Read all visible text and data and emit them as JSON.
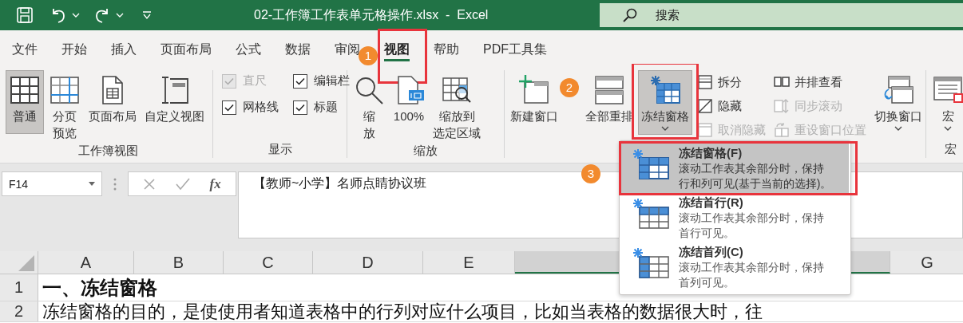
{
  "title_bar": {
    "title": "02-工作簿工作表单元格操作.xlsx  -  Excel",
    "search_placeholder": "搜索"
  },
  "tabs": [
    {
      "label": "文件",
      "selected": false
    },
    {
      "label": "开始",
      "selected": false
    },
    {
      "label": "插入",
      "selected": false
    },
    {
      "label": "页面布局",
      "selected": false
    },
    {
      "label": "公式",
      "selected": false
    },
    {
      "label": "数据",
      "selected": false
    },
    {
      "label": "审阅",
      "selected": false
    },
    {
      "label": "视图",
      "selected": true,
      "outlined": true
    },
    {
      "label": "帮助",
      "selected": false
    },
    {
      "label": "PDF工具集",
      "selected": false
    }
  ],
  "ribbon": {
    "groups": [
      {
        "label": "工作簿视图",
        "items": [
          {
            "kind": "large",
            "label": "普通",
            "selected": true
          },
          {
            "kind": "large",
            "label": [
              "分页",
              "预览"
            ],
            "selected": false
          },
          {
            "kind": "large",
            "label": "页面布局",
            "selected": false
          },
          {
            "kind": "large",
            "label": "自定义视图",
            "selected": false
          }
        ]
      },
      {
        "label": "显示",
        "items": [
          {
            "kind": "check",
            "label": "直尺",
            "checked": true,
            "disabled": true
          },
          {
            "kind": "check",
            "label": "编辑栏",
            "checked": true,
            "disabled": false
          },
          {
            "kind": "check",
            "label": "网格线",
            "checked": true,
            "disabled": false
          },
          {
            "kind": "check",
            "label": "标题",
            "checked": true,
            "disabled": false
          }
        ]
      },
      {
        "label": "缩放",
        "items": [
          {
            "kind": "large",
            "label": [
              "缩",
              "放"
            ],
            "selected": false
          },
          {
            "kind": "large",
            "label": "100%",
            "selected": false
          },
          {
            "kind": "large",
            "label": [
              "缩放到",
              "选定区域"
            ],
            "selected": false
          }
        ]
      },
      {
        "items": [
          {
            "kind": "large",
            "label": "新建窗口",
            "selected": false
          },
          {
            "kind": "large",
            "label": "全部重排",
            "selected": false
          },
          {
            "kind": "large",
            "label": "冻结窗格",
            "selected": true,
            "dropdown": true,
            "outlined": true
          },
          {
            "kind": "stack",
            "items": [
              {
                "label": "拆分",
                "disabled": false
              },
              {
                "label": "隐藏",
                "disabled": false
              },
              {
                "label": "取消隐藏",
                "disabled": true
              }
            ]
          },
          {
            "kind": "stack",
            "items": [
              {
                "label": "并排查看",
                "disabled": false
              },
              {
                "label": "同步滚动",
                "disabled": true
              },
              {
                "label": "重设窗口位置",
                "disabled": true
              }
            ]
          },
          {
            "kind": "large",
            "label": "切换窗口",
            "selected": false,
            "dropdown": true
          }
        ]
      },
      {
        "label": "宏",
        "items": [
          {
            "kind": "large",
            "label": "宏",
            "selected": false,
            "dropdown": true
          }
        ]
      }
    ]
  },
  "formula_bar": {
    "name_box": "F14",
    "function_label": "fx",
    "content": "【教师~小学】名师点睛协议班"
  },
  "sheet": {
    "columns": [
      {
        "label": "A",
        "selected": false
      },
      {
        "label": "B",
        "selected": false
      },
      {
        "label": "C",
        "selected": false
      },
      {
        "label": "D",
        "selected": false
      },
      {
        "label": "E",
        "selected": false
      },
      {
        "selected": true
      },
      {
        "label": "G",
        "selected": false
      }
    ],
    "rows": [
      {
        "number": "1",
        "kind": "heading",
        "text": "一、冻结窗格"
      },
      {
        "number": "2",
        "kind": "body",
        "text": "冻结窗格的目的，是使使用者知道表格中的行列对应什么项目，比如当表格的数据很大时，往"
      }
    ]
  },
  "freeze_menu": {
    "items": [
      {
        "title": "冻结窗格(F)",
        "description": "滚动工作表其余部分时，保持行和列可见(基于当前的选择)。",
        "selected": true,
        "outlined": true
      },
      {
        "title": "冻结首行(R)",
        "description": "滚动工作表其余部分时，保持首行可见。",
        "selected": false
      },
      {
        "title": "冻结首列(C)",
        "description": "滚动工作表其余部分时，保持首列可见。",
        "selected": false
      }
    ]
  },
  "callouts": [
    {
      "label": "1"
    },
    {
      "label": "2"
    },
    {
      "label": "3"
    }
  ]
}
